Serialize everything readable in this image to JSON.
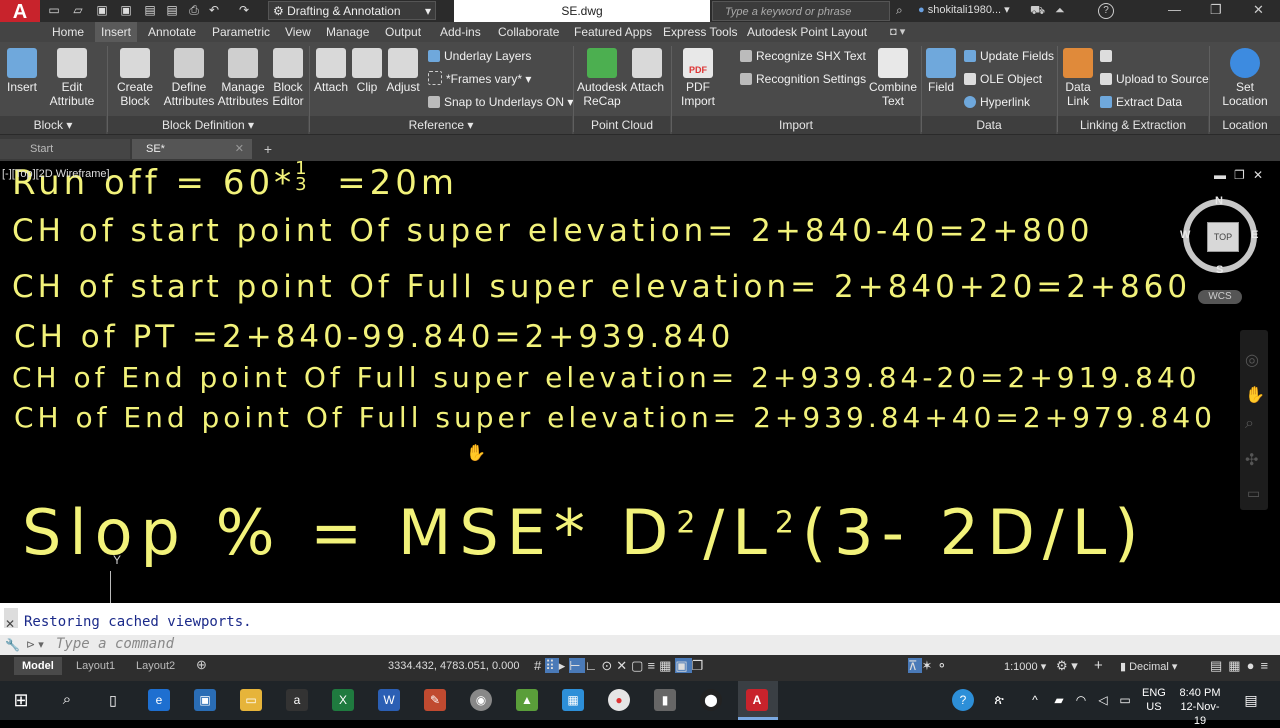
{
  "titlebar": {
    "logo": "A",
    "workspace": "Drafting & Annotation",
    "filename": "SE.dwg",
    "search_placeholder": "Type a keyword or phrase",
    "user": "shokitali1980...",
    "help": "?"
  },
  "ribbon_tabs": [
    "Home",
    "Insert",
    "Annotate",
    "Parametric",
    "View",
    "Manage",
    "Output",
    "Add-ins",
    "Collaborate",
    "Featured Apps",
    "Express Tools",
    "Autodesk Point Layout"
  ],
  "active_tab": "Insert",
  "ribbon": {
    "block": {
      "panel": "Block",
      "insert": "Insert",
      "edit_attribute_1": "Edit",
      "edit_attribute_2": "Attribute"
    },
    "block_def": {
      "panel": "Block Definition",
      "create_1": "Create",
      "create_2": "Block",
      "define_1": "Define",
      "define_2": "Attributes",
      "manage_1": "Manage",
      "manage_2": "Attributes",
      "editor_1": "Block",
      "editor_2": "Editor"
    },
    "reference": {
      "panel": "Reference",
      "attach": "Attach",
      "clip": "Clip",
      "adjust": "Adjust",
      "underlay_layers": "Underlay Layers",
      "frames_vary": "*Frames vary*",
      "snap_underlays": "Snap to Underlays ON"
    },
    "point_cloud": {
      "panel": "Point Cloud",
      "recap_1": "Autodesk",
      "recap_2": "ReCap",
      "attach": "Attach"
    },
    "import": {
      "panel": "Import",
      "pdf_1": "PDF",
      "pdf_2": "Import",
      "pdf_badge": "PDF",
      "recognize_shx": "Recognize SHX Text",
      "recognition_settings": "Recognition Settings",
      "combine_1": "Combine",
      "combine_2": "Text"
    },
    "data": {
      "panel": "Data",
      "field": "Field",
      "update_fields": "Update Fields",
      "ole_object": "OLE Object",
      "hyperlink": "Hyperlink"
    },
    "linking": {
      "panel": "Linking & Extraction",
      "data_link_1": "Data",
      "data_link_2": "Link",
      "upload_source": "Upload to Source",
      "extract_data": "Extract  Data"
    },
    "location": {
      "panel": "Location",
      "set_1": "Set",
      "set_2": "Location"
    }
  },
  "doc_tabs": [
    "Start",
    "SE*"
  ],
  "viewport_label": "[-][Top][2D Wireframe]",
  "drawing_text": {
    "line0": "Run off  =  60*",
    "line0_frac": "1",
    "line0_den": "3",
    "line0_res": "=20m",
    "line1": "CH  of  start  point  Of  super  elevation=  2+840-40=2+800",
    "line2": "CH  of  start  point  Of  Full  super  elevation=  2+840+20=2+860",
    "line3": "CH  of  PT  =2+840-99.840=2+939.840",
    "line4": "CH  of  End  point  Of  Full  super  elevation=   2+939.84-20=2+919.840",
    "line5": "CH  of  End  point  Of  Full  super  elevation=   2+939.84+40=2+979.840",
    "slope_a": "Slop  %  =  MSE*  D",
    "sup_2": "2",
    "slope_b": "/L",
    "slope_c": "(3-  2D/L)",
    "ucs_y": "Y"
  },
  "viewcube": {
    "n": "N",
    "s": "S",
    "e": "E",
    "w": "W",
    "top": "TOP",
    "wcs": "WCS"
  },
  "command": {
    "history": "Restoring cached viewports.",
    "placeholder": "Type a command"
  },
  "layout_tabs": [
    "Model",
    "Layout1",
    "Layout2"
  ],
  "status": {
    "coords": "3334.432, 4783.051, 0.000",
    "scale": "1:1000",
    "units": "Decimal"
  },
  "taskbar": {
    "lang_1": "ENG",
    "lang_2": "US",
    "time": "8:40 PM",
    "date": "12-Nov-19"
  }
}
